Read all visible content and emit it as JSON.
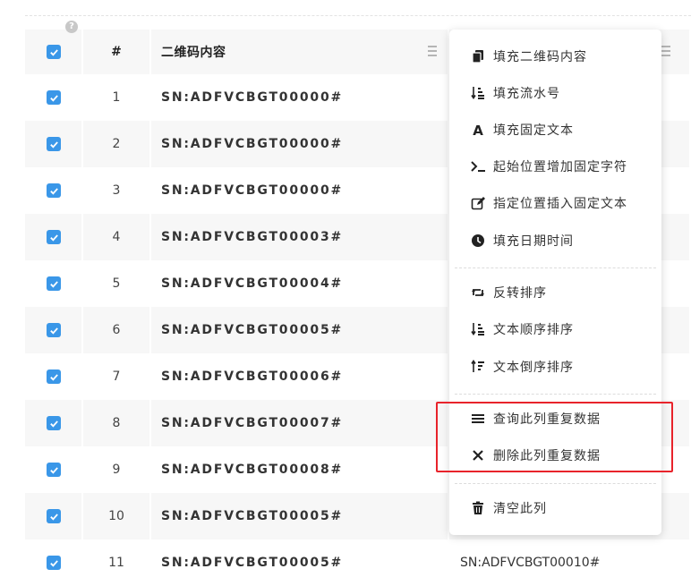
{
  "table": {
    "header": {
      "index_label": "#",
      "content_label": "二维码内容",
      "help_glyph": "?"
    },
    "rows": [
      {
        "index": "1",
        "content": "SN:ADFVCBGT00000#",
        "checked": true
      },
      {
        "index": "2",
        "content": "SN:ADFVCBGT00000#",
        "checked": true
      },
      {
        "index": "3",
        "content": "SN:ADFVCBGT00000#",
        "checked": true
      },
      {
        "index": "4",
        "content": "SN:ADFVCBGT00003#",
        "checked": true
      },
      {
        "index": "5",
        "content": "SN:ADFVCBGT00004#",
        "checked": true
      },
      {
        "index": "6",
        "content": "SN:ADFVCBGT00005#",
        "checked": true
      },
      {
        "index": "7",
        "content": "SN:ADFVCBGT00006#",
        "checked": true
      },
      {
        "index": "8",
        "content": "SN:ADFVCBGT00007#",
        "checked": true
      },
      {
        "index": "9",
        "content": "SN:ADFVCBGT00008#",
        "checked": true
      },
      {
        "index": "10",
        "content": "SN:ADFVCBGT00005#",
        "checked": true
      },
      {
        "index": "11",
        "content": "SN:ADFVCBGT00005#",
        "checked": true,
        "extra": "SN:ADFVCBGT00010#"
      }
    ]
  },
  "context_menu": {
    "items": [
      {
        "icon": "copy-icon",
        "label": "填充二维码内容"
      },
      {
        "icon": "sort-numeric-icon",
        "label": "填充流水号"
      },
      {
        "icon": "font-icon",
        "label": "填充固定文本"
      },
      {
        "icon": "terminal-icon",
        "label": "起始位置增加固定字符"
      },
      {
        "icon": "edit-icon",
        "label": "指定位置插入固定文本"
      },
      {
        "icon": "clock-icon",
        "label": "填充日期时间"
      },
      {
        "icon": "retweet-icon",
        "label": "反转排序"
      },
      {
        "icon": "sort-asc-icon",
        "label": "文本顺序排序"
      },
      {
        "icon": "sort-desc-icon",
        "label": "文本倒序排序"
      },
      {
        "icon": "list-icon",
        "label": "查询此列重复数据"
      },
      {
        "icon": "close-icon",
        "label": "删除此列重复数据"
      },
      {
        "icon": "trash-icon",
        "label": "清空此列"
      }
    ]
  },
  "colors": {
    "checkbox": "#3a97e8",
    "highlight_border": "#e8232b",
    "stripe": "#f7f7f7"
  }
}
